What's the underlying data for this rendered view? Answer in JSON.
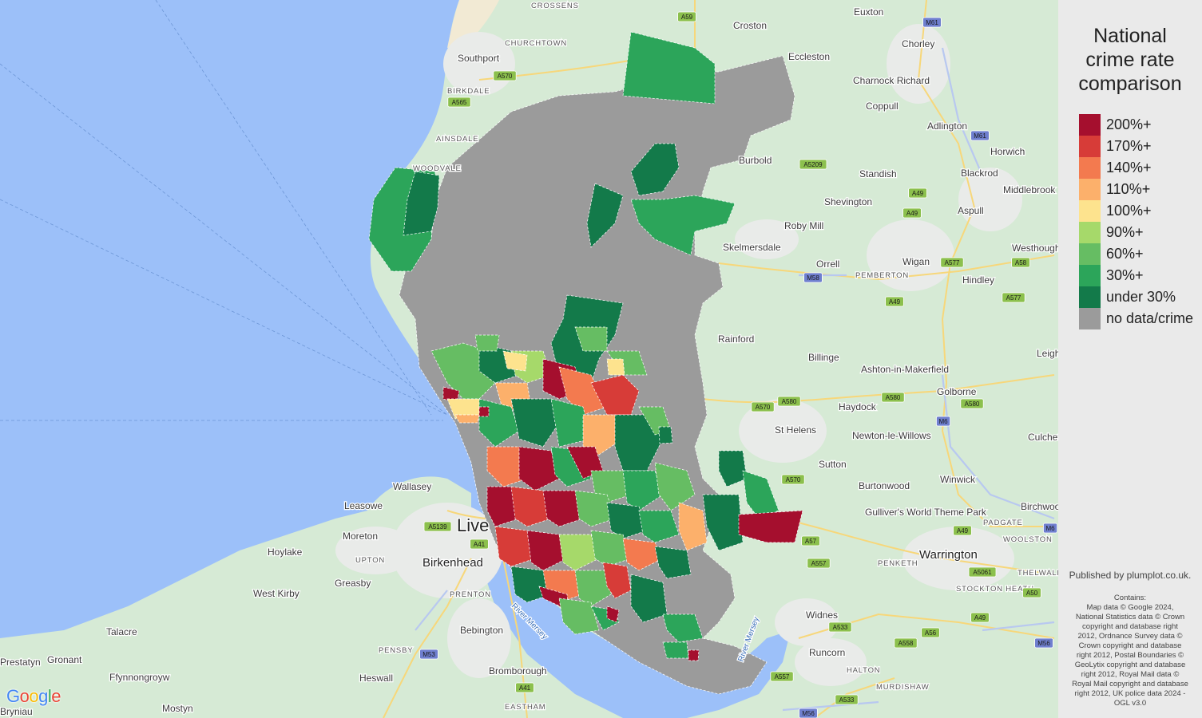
{
  "legend": {
    "title_lines": [
      "National",
      "crime rate",
      "comparison"
    ],
    "items": [
      {
        "label": "200%+",
        "color": "#a50f2e"
      },
      {
        "label": "170%+",
        "color": "#d73c38"
      },
      {
        "label": "140%+",
        "color": "#f37a4f"
      },
      {
        "label": "110%+",
        "color": "#fcb06b"
      },
      {
        "label": "100%+",
        "color": "#fde38e"
      },
      {
        "label": "90%+",
        "color": "#a6d96a"
      },
      {
        "label": "60%+",
        "color": "#66bd63"
      },
      {
        "label": "30%+",
        "color": "#2ca55a"
      },
      {
        "label": "under 30%",
        "color": "#137a4a"
      },
      {
        "label": "no data/crime",
        "color": "#9b9b9b"
      }
    ]
  },
  "published": "Published by plumplot.co.uk.",
  "contains_lines": [
    "Contains:",
    "Map data © Google 2024,",
    "National Statistics data © Crown",
    "copyright and database right",
    "2012, Ordnance Survey data ©",
    "Crown copyright and database",
    "right 2012, Postal Boundaries ©",
    "GeoLytix copyright and database",
    "right 2012, Royal Mail data ©",
    "Royal Mail copyright and database",
    "right 2012, UK police data 2024 -",
    "OGL v3.0"
  ],
  "map": {
    "google": "Google",
    "colors": {
      "sea": "#9cc0f9",
      "land": "#d6ead5",
      "urban": "#e6e8e6",
      "grey": "#9b9b9b"
    },
    "places": [
      {
        "name": "CROSSENS",
        "style": "caps"
      },
      {
        "name": "CHURCHTOWN",
        "style": "caps"
      },
      {
        "name": "Southport",
        "style": "normal"
      },
      {
        "name": "BIRKDALE",
        "style": "caps"
      },
      {
        "name": "AINSDALE",
        "style": "caps"
      },
      {
        "name": "WOODVALE",
        "style": "caps"
      },
      {
        "name": "Croston",
        "style": "normal"
      },
      {
        "name": "Eccleston",
        "style": "normal"
      },
      {
        "name": "Euxton",
        "style": "normal"
      },
      {
        "name": "Chorley",
        "style": "normal"
      },
      {
        "name": "Charnock Richard",
        "style": "normal"
      },
      {
        "name": "Coppull",
        "style": "normal"
      },
      {
        "name": "Adlington",
        "style": "normal"
      },
      {
        "name": "Horwich",
        "style": "normal"
      },
      {
        "name": "Burbold",
        "style": "normal"
      },
      {
        "name": "Standish",
        "style": "normal"
      },
      {
        "name": "Blackrod",
        "style": "normal"
      },
      {
        "name": "Middlebrook",
        "style": "normal"
      },
      {
        "name": "Shevington",
        "style": "normal"
      },
      {
        "name": "Aspull",
        "style": "normal"
      },
      {
        "name": "Roby Mill",
        "style": "normal"
      },
      {
        "name": "Skelmersdale",
        "style": "normal"
      },
      {
        "name": "Orrell",
        "style": "normal"
      },
      {
        "name": "Wigan",
        "style": "normal"
      },
      {
        "name": "Westhoughton",
        "style": "normal"
      },
      {
        "name": "PEMBERTON",
        "style": "caps"
      },
      {
        "name": "Hindley",
        "style": "normal"
      },
      {
        "name": "Rainford",
        "style": "normal"
      },
      {
        "name": "Billinge",
        "style": "normal"
      },
      {
        "name": "Ashton-in-Makerfield",
        "style": "normal"
      },
      {
        "name": "Leigh",
        "style": "normal"
      },
      {
        "name": "Golborne",
        "style": "normal"
      },
      {
        "name": "Haydock",
        "style": "normal"
      },
      {
        "name": "St Helens",
        "style": "normal"
      },
      {
        "name": "Newton-le-Willows",
        "style": "normal"
      },
      {
        "name": "Culcheth",
        "style": "normal"
      },
      {
        "name": "Sutton",
        "style": "normal"
      },
      {
        "name": "Burtonwood",
        "style": "normal"
      },
      {
        "name": "Winwick",
        "style": "normal"
      },
      {
        "name": "Birchwood",
        "style": "normal"
      },
      {
        "name": "Gulliver's World Theme Park",
        "style": "poi"
      },
      {
        "name": "PADGATE",
        "style": "caps"
      },
      {
        "name": "WOOLSTON",
        "style": "caps"
      },
      {
        "name": "Warrington",
        "style": "big"
      },
      {
        "name": "PENKETH",
        "style": "caps"
      },
      {
        "name": "THELWALL",
        "style": "caps"
      },
      {
        "name": "STOCKTON HEATH",
        "style": "caps"
      },
      {
        "name": "Widnes",
        "style": "normal"
      },
      {
        "name": "Runcorn",
        "style": "normal"
      },
      {
        "name": "HALTON",
        "style": "caps"
      },
      {
        "name": "MURDISHAW",
        "style": "caps"
      },
      {
        "name": "Wallasey",
        "style": "normal"
      },
      {
        "name": "Leasowe",
        "style": "normal"
      },
      {
        "name": "Moreton",
        "style": "normal"
      },
      {
        "name": "Hoylake",
        "style": "normal"
      },
      {
        "name": "UPTON",
        "style": "caps"
      },
      {
        "name": "Birkenhead",
        "style": "big"
      },
      {
        "name": "Greasby",
        "style": "normal"
      },
      {
        "name": "West Kirby",
        "style": "normal"
      },
      {
        "name": "PRENTON",
        "style": "caps"
      },
      {
        "name": "Bebington",
        "style": "normal"
      },
      {
        "name": "Talacre",
        "style": "normal"
      },
      {
        "name": "Prestatyn",
        "style": "normal"
      },
      {
        "name": "Gronant",
        "style": "normal"
      },
      {
        "name": "PENSBY",
        "style": "caps"
      },
      {
        "name": "Heswall",
        "style": "normal"
      },
      {
        "name": "Ffynnongroyw",
        "style": "normal"
      },
      {
        "name": "Bromborough",
        "style": "normal"
      },
      {
        "name": "EASTHAM",
        "style": "caps"
      },
      {
        "name": "Mostyn",
        "style": "normal"
      },
      {
        "name": "Bryniau",
        "style": "normal"
      },
      {
        "name": "Live",
        "style": "xl"
      },
      {
        "name": "River Mersey",
        "style": "water"
      },
      {
        "name": "River Mersey",
        "style": "water"
      }
    ],
    "roads": [
      "A565",
      "A59",
      "A570",
      "A565",
      "M61",
      "M61",
      "A5209",
      "A49",
      "A49",
      "A577",
      "A58",
      "A577",
      "M58",
      "A49",
      "A570",
      "A580",
      "A580",
      "A580",
      "M6",
      "A570",
      "A49",
      "M6",
      "A57",
      "A557",
      "A5061",
      "A50",
      "A49",
      "A533",
      "A558",
      "A56",
      "M56",
      "A557",
      "A533",
      "M56",
      "A5139",
      "A41",
      "M53",
      "A41"
    ]
  }
}
